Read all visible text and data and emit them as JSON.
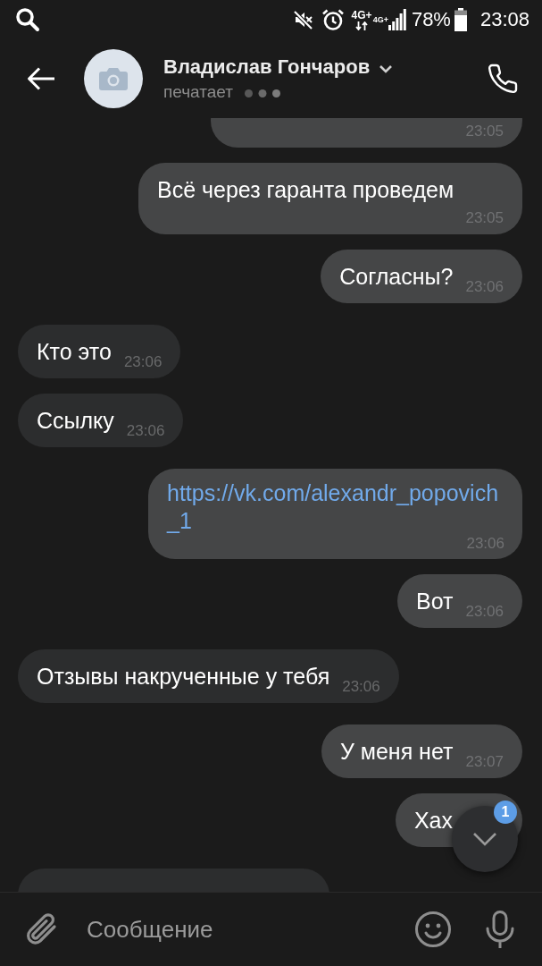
{
  "status_bar": {
    "network_labels": [
      "4G+",
      "4G+"
    ],
    "battery": "78%",
    "time": "23:08"
  },
  "header": {
    "name": "Владислав Гончаров",
    "status": "печатает"
  },
  "messages": [
    {
      "outgoing": true,
      "kind": "text",
      "time": "23:05"
    },
    {
      "outgoing": true,
      "kind": "text",
      "text": "Всё через гаранта проведем",
      "time": "23:05"
    },
    {
      "outgoing": true,
      "kind": "text",
      "text": "Согласны?",
      "time": "23:06"
    },
    {
      "outgoing": false,
      "kind": "text",
      "text": "Кто это",
      "time": "23:06"
    },
    {
      "outgoing": false,
      "kind": "text",
      "text": "Ссылку",
      "time": "23:06"
    },
    {
      "outgoing": true,
      "kind": "link",
      "text": "https://vk.com/alexandr_popovich_1",
      "time": "23:06"
    },
    {
      "outgoing": true,
      "kind": "text",
      "text": "Вот",
      "time": "23:06"
    },
    {
      "outgoing": false,
      "kind": "text",
      "text": "Отзывы накрученные у тебя",
      "time": "23:06"
    },
    {
      "outgoing": true,
      "kind": "text",
      "text": "У меня нет",
      "time": "23:07"
    },
    {
      "outgoing": true,
      "kind": "text",
      "text": "Хах"
    },
    {
      "outgoing": false,
      "kind": "text"
    }
  ],
  "scroll_down": {
    "badge": "1"
  },
  "composer": {
    "placeholder": "Сообщение"
  }
}
